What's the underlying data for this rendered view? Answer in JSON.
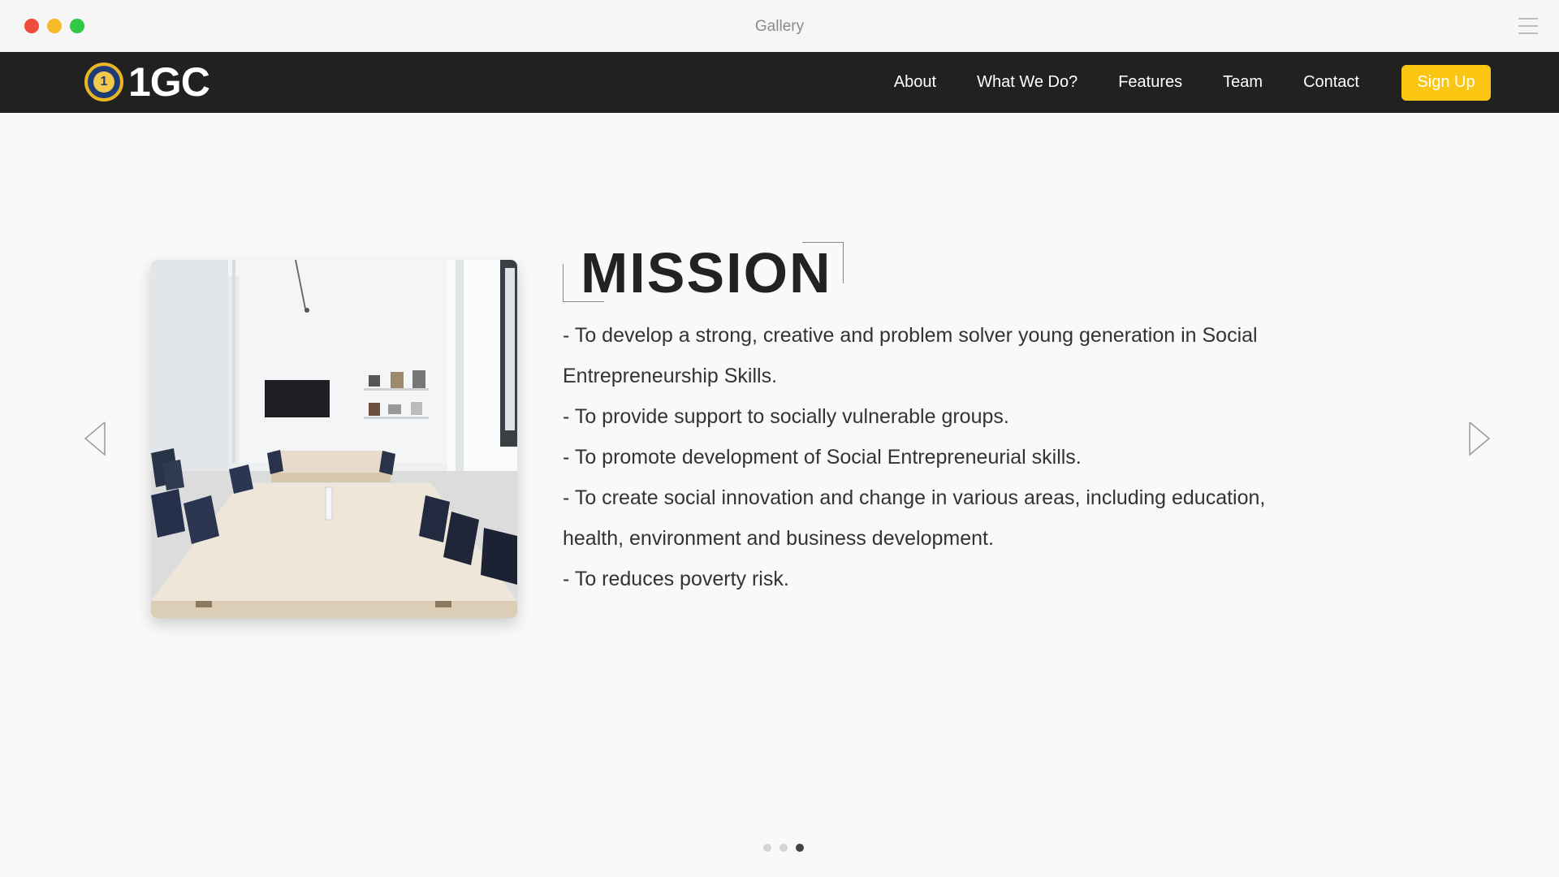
{
  "window": {
    "title": "Gallery"
  },
  "nav": {
    "logo_text": "1GC",
    "links": [
      "About",
      "What We Do?",
      "Features",
      "Team",
      "Contact"
    ],
    "signup_label": "Sign Up"
  },
  "slide": {
    "title": "MISSION",
    "lines": [
      "- To develop a strong, creative and problem solver young generation in Social Entrepreneurship Skills.",
      "- To provide support to socially vulnerable groups.",
      "- To promote development of Social Entrepreneurial skills.",
      "- To create social innovation and change in various areas, including education, health, environment and business development.",
      "- To reduces poverty risk."
    ]
  },
  "carousel": {
    "total": 3,
    "active": 3
  },
  "icons": {
    "prev": "chevron-left-icon",
    "next": "chevron-right-icon",
    "menu": "hamburger-icon"
  },
  "colors": {
    "nav_bg": "#212121",
    "accent": "#fbc611",
    "page_bg": "#f9f9f9"
  }
}
